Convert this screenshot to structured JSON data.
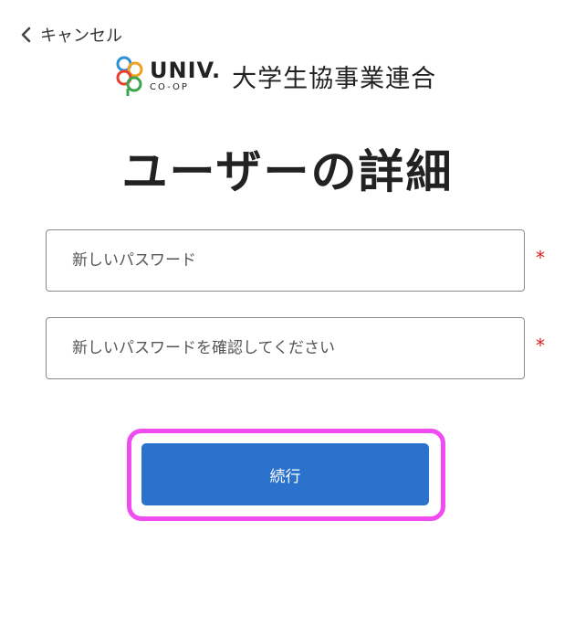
{
  "nav": {
    "cancel_label": "キャンセル"
  },
  "brand": {
    "univ_main": "UNIV.",
    "univ_sub": "CO-OP",
    "org_name": "大学生協事業連合"
  },
  "page": {
    "title": "ユーザーの詳細"
  },
  "form": {
    "new_password": {
      "placeholder": "新しいパスワード",
      "value": "",
      "required_mark": "*"
    },
    "confirm_password": {
      "placeholder": "新しいパスワードを確認してください",
      "value": "",
      "required_mark": "*"
    },
    "submit_label": "続行"
  },
  "colors": {
    "primary": "#2b72cc",
    "highlight": "#f04cf0",
    "required": "#e02020"
  }
}
